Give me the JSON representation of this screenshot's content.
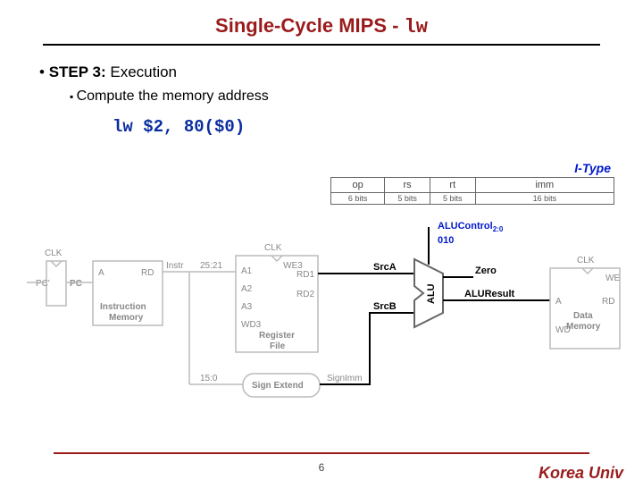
{
  "title_prefix": "Single-Cycle MIPS - ",
  "title_code": "lw",
  "step": {
    "label": "STEP 3:",
    "name": "Execution"
  },
  "subpoint": "Compute the memory address",
  "code": "lw $2, 80($0)",
  "itype": {
    "label": "I-Type",
    "fields": [
      "op",
      "rs",
      "rt",
      "imm"
    ],
    "bits": [
      "6 bits",
      "5 bits",
      "5 bits",
      "16 bits"
    ]
  },
  "alu": {
    "control_label": "ALUControl",
    "control_sub": "2:0",
    "control_value": "010",
    "srcA": "SrcA",
    "srcB": "SrcB",
    "zero": "Zero",
    "result": "ALUResult",
    "name": "ALU"
  },
  "blocks": {
    "pc": "PC",
    "pcprime": "PC'",
    "imem": "Instruction\nMemory",
    "imem_A": "A",
    "imem_RD": "RD",
    "instr": "Instr",
    "rf": "Register\nFile",
    "rf_ports": {
      "a1": "A1",
      "a2": "A2",
      "a3": "A3",
      "wd3": "WD3",
      "rd1": "RD1",
      "rd2": "RD2",
      "we3": "WE3"
    },
    "slice1": "25:21",
    "slice2": "15:0",
    "signext": "Sign Extend",
    "signimm": "SignImm",
    "dmem": "Data\nMemory",
    "dmem_ports": {
      "a": "A",
      "rd": "RD",
      "wd": "WD",
      "we": "WE"
    },
    "clk": "CLK"
  },
  "page": "6",
  "footer": "Korea Univ"
}
